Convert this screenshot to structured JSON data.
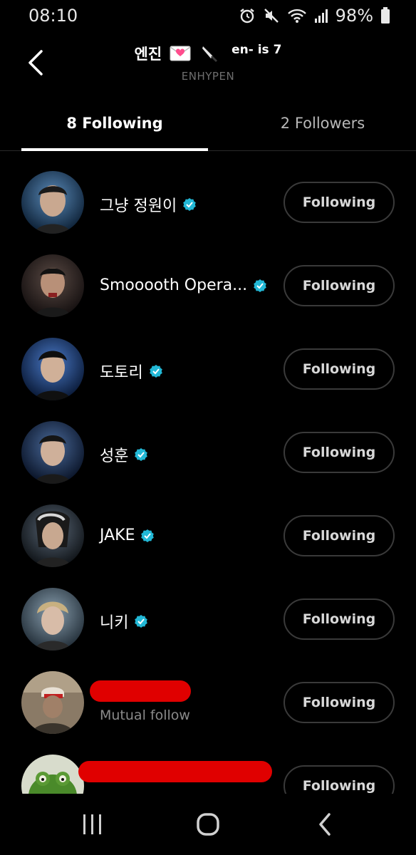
{
  "status_bar": {
    "time": "08:10",
    "battery": "98%",
    "icons": [
      "alarm-icon",
      "mute-icon",
      "wifi-icon",
      "signal-icon",
      "battery-icon"
    ]
  },
  "header": {
    "title": "엔진",
    "title_suffix": "en- is 7",
    "subtitle": "ENHYPEN",
    "emojis": [
      "love-letter-icon",
      "knife-icon"
    ]
  },
  "tabs": [
    {
      "label": "8 Following",
      "active": true
    },
    {
      "label": "2 Followers",
      "active": false
    }
  ],
  "list": [
    {
      "name": "그냥 정원이",
      "verified": true,
      "button": "Following",
      "avatar_color": "#1e3a5a"
    },
    {
      "name": "Smooooth Opera...",
      "verified": true,
      "button": "Following",
      "avatar_color": "#3a2a25"
    },
    {
      "name": "도토리",
      "verified": true,
      "button": "Following",
      "avatar_color": "#1b3a66"
    },
    {
      "name": "성훈",
      "verified": true,
      "button": "Following",
      "avatar_color": "#1d3150"
    },
    {
      "name": "JAKE",
      "verified": true,
      "button": "Following",
      "avatar_color": "#2a2e38"
    },
    {
      "name": "니키",
      "verified": true,
      "button": "Following",
      "avatar_color": "#4a5a6a"
    },
    {
      "name": "",
      "verified": false,
      "subtitle": "Mutual follow",
      "button": "Following",
      "avatar_color": "#6a5a48"
    },
    {
      "name": "",
      "verified": false,
      "button": "Following",
      "avatar_color": "#4a7a2a"
    }
  ],
  "colors": {
    "verified": "#22b8d6",
    "redaction": "#e00000"
  }
}
